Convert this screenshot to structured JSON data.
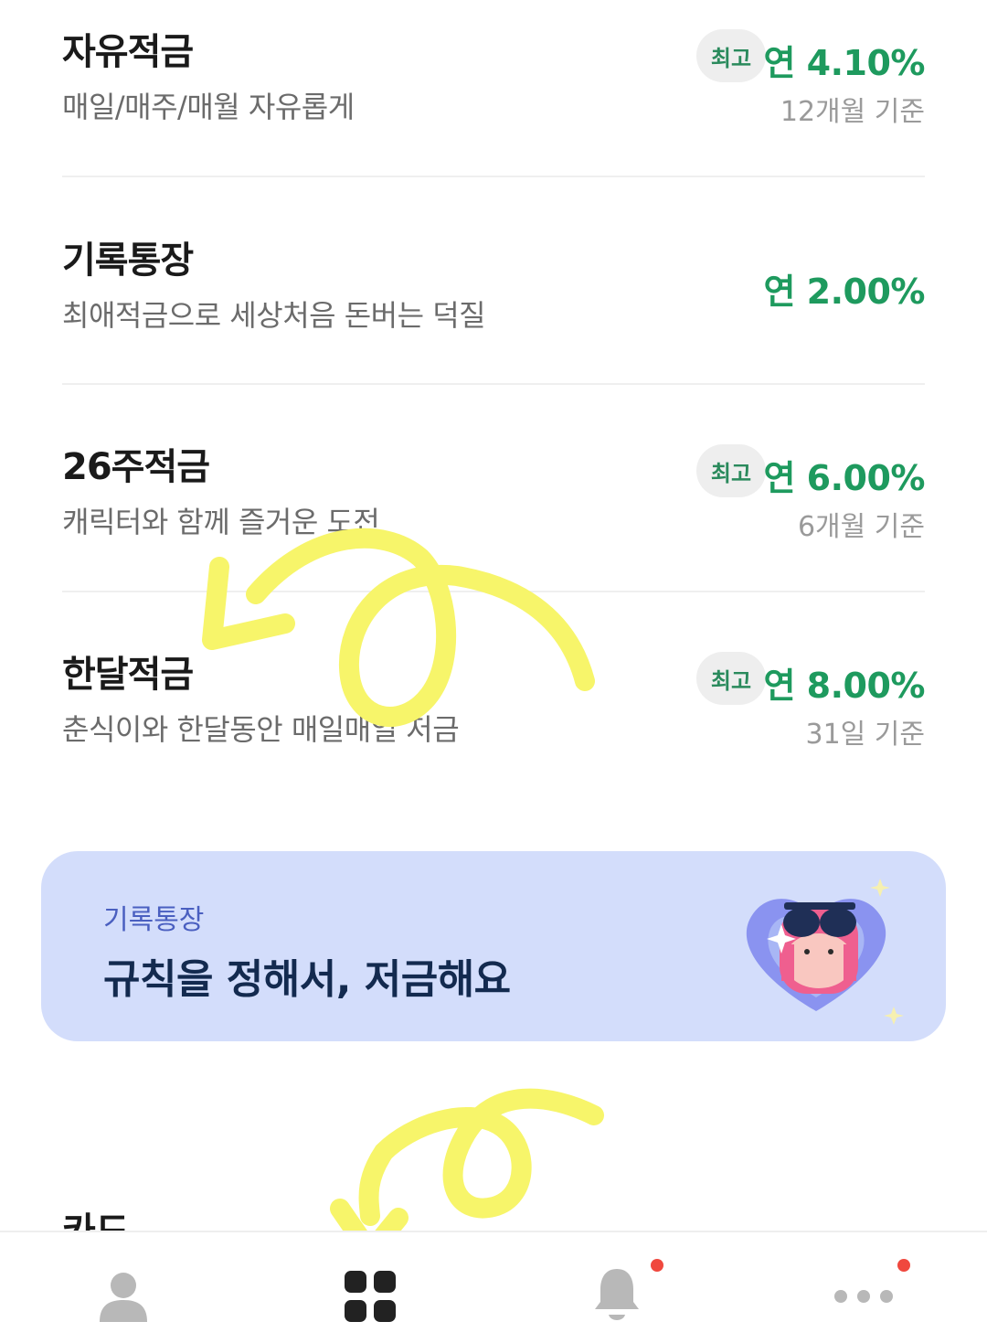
{
  "products": [
    {
      "name": "자유적금",
      "desc": "매일/매주/매월 자유롭게",
      "badge": "최고",
      "rate": "연 4.10%",
      "basis": "12개월 기준"
    },
    {
      "name": "기록통장",
      "desc": "최애적금으로 세상처음 돈버는 덕질",
      "rate": "연 2.00%"
    },
    {
      "name": "26주적금",
      "desc": "캐릭터와 함께 즐거운 도전",
      "badge": "최고",
      "rate": "연 6.00%",
      "basis": "6개월 기준"
    },
    {
      "name": "한달적금",
      "desc": "춘식이와 한달동안 매일매일 저금",
      "badge": "최고",
      "rate": "연 8.00%",
      "basis": "31일 기준"
    }
  ],
  "banner": {
    "subtitle": "기록통장",
    "title": "규칙을 정해서, 저금해요"
  },
  "next_section": {
    "title": "카드"
  },
  "tabbar": [
    {
      "icon": "person-icon",
      "active": false,
      "notification": false
    },
    {
      "icon": "grid-icon",
      "active": true,
      "notification": false
    },
    {
      "icon": "bell-icon",
      "active": false,
      "notification": true
    },
    {
      "icon": "more-icon",
      "active": false,
      "notification": true
    }
  ],
  "colors": {
    "rate_green": "#1e9a5e",
    "badge_bg": "#eeeeee",
    "banner_bg": "#d3ddfb",
    "banner_title": "#132a4f",
    "notification_red": "#f0483e",
    "scribble_yellow": "#f7f56a"
  }
}
